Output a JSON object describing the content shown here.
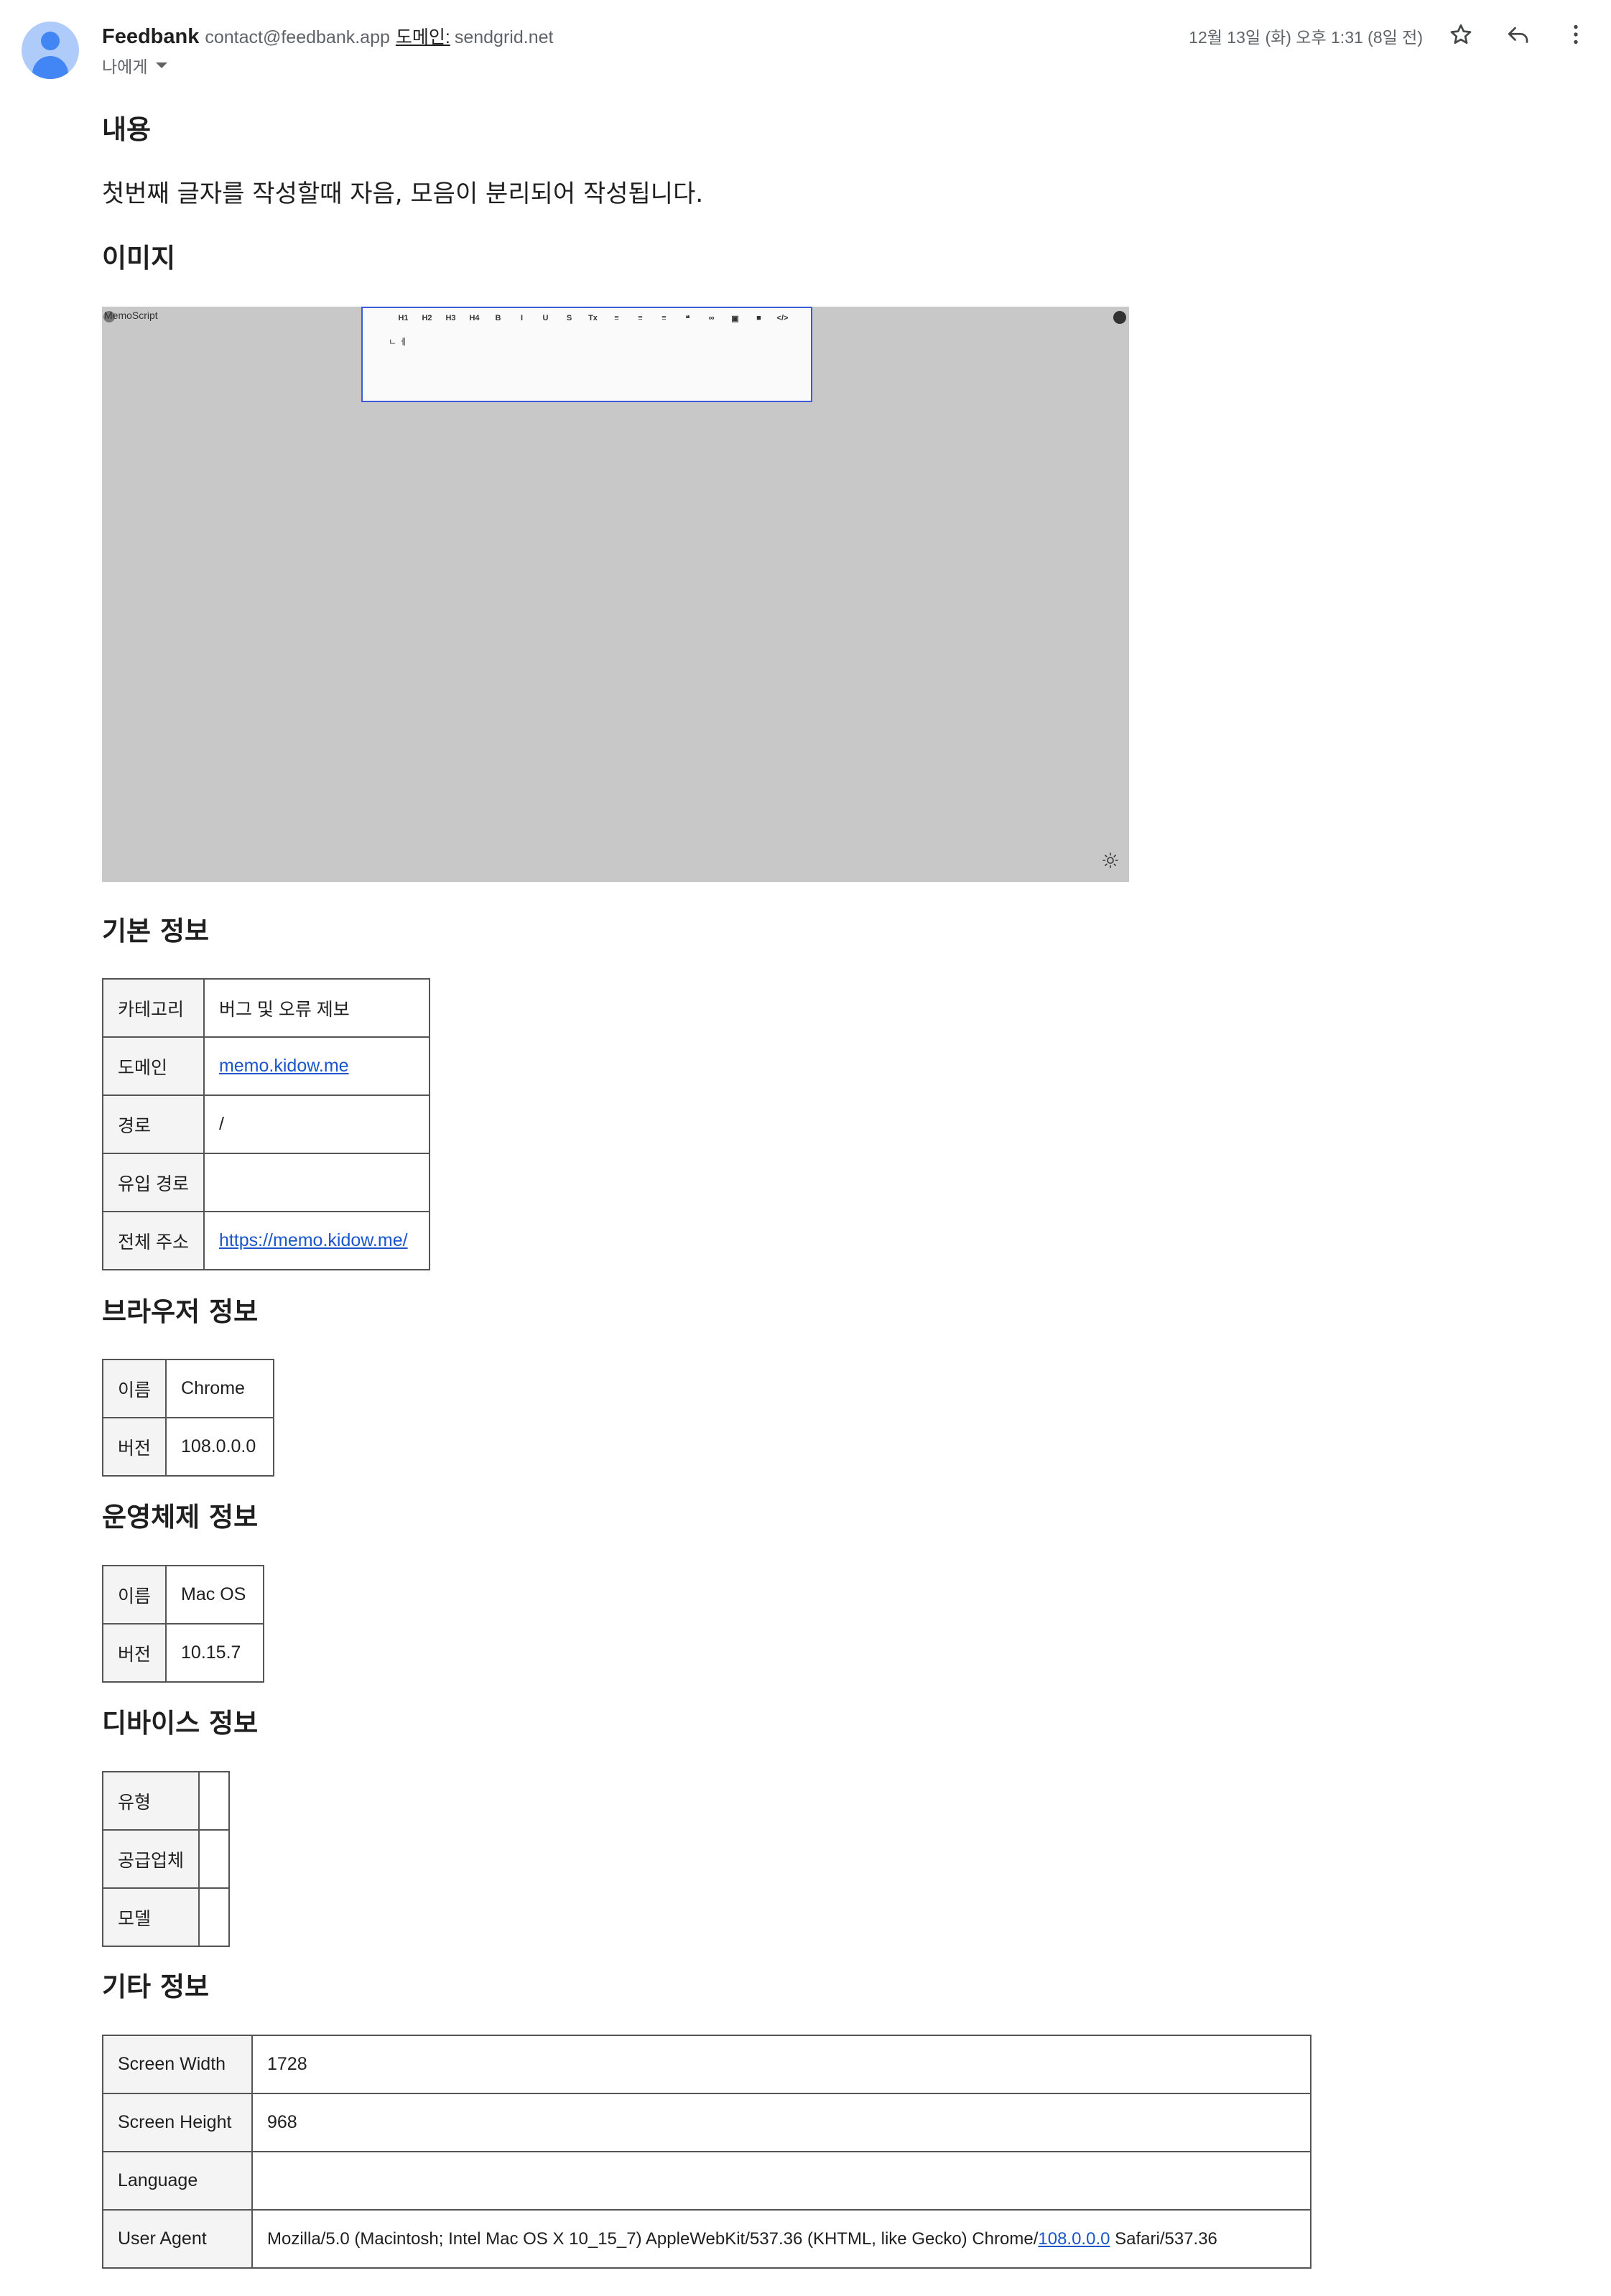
{
  "header": {
    "sender_name": "Feedbank",
    "sender_email": "contact@feedbank.app",
    "domain_label": "도메인:",
    "domain_value": "sendgrid.net",
    "to_label": "나에게",
    "date": "12월 13일 (화) 오후 1:31 (8일 전)",
    "icons": [
      "star-icon",
      "reply-icon",
      "more-vert-icon"
    ]
  },
  "content": {
    "heading": "내용",
    "text": "첫번째 글자를 작성할때 자음, 모음이 분리되어 작성됩니다."
  },
  "image_section": {
    "heading": "이미지",
    "screenshot": {
      "logo_text": "MemoScript",
      "toolbar": [
        "H1",
        "H2",
        "H3",
        "H4",
        "B",
        "I",
        "U",
        "S",
        "Tx",
        "≡",
        "≡",
        "≡",
        "❝",
        "∞",
        "▣",
        "■",
        "</>"
      ],
      "typed_text": "ㄴ ㅔ"
    }
  },
  "basic_info": {
    "heading": "기본 정보",
    "rows": [
      {
        "key": "카테고리",
        "value": "버그 및 오류 제보",
        "link": false
      },
      {
        "key": "도메인",
        "value": "memo.kidow.me",
        "link": true
      },
      {
        "key": "경로",
        "value": "/",
        "link": false
      },
      {
        "key": "유입 경로",
        "value": "",
        "link": false
      },
      {
        "key": "전체 주소",
        "value": "https://memo.kidow.me/",
        "link": true
      }
    ]
  },
  "browser_info": {
    "heading": "브라우저 정보",
    "rows": [
      {
        "key": "이름",
        "value": "Chrome"
      },
      {
        "key": "버전",
        "value": "108.0.0.0"
      }
    ]
  },
  "os_info": {
    "heading": "운영체제 정보",
    "rows": [
      {
        "key": "이름",
        "value": "Mac OS"
      },
      {
        "key": "버전",
        "value": "10.15.7"
      }
    ]
  },
  "device_info": {
    "heading": "디바이스 정보",
    "rows": [
      {
        "key": "유형",
        "value": ""
      },
      {
        "key": "공급업체",
        "value": ""
      },
      {
        "key": "모델",
        "value": ""
      }
    ]
  },
  "other_info": {
    "heading": "기타 정보",
    "rows": [
      {
        "key": "Screen Width",
        "value": "1728"
      },
      {
        "key": "Screen Height",
        "value": "968"
      },
      {
        "key": "Language",
        "value": ""
      },
      {
        "key": "User Agent",
        "value_before": "Mozilla/5.0 (Macintosh; Intel Mac OS X 10_15_7) AppleWebKit/537.36 (KHTML, like Gecko) Chrome/",
        "value_link": "108.0.0.0",
        "value_after": " Safari/537.36"
      }
    ]
  },
  "colors": {
    "avatar_bg": "#aecbfa",
    "avatar_fg": "#4285f4",
    "link": "#1a55c9",
    "screenshot_bg": "#c8c8c8",
    "editor_border": "#3b5bdb"
  }
}
